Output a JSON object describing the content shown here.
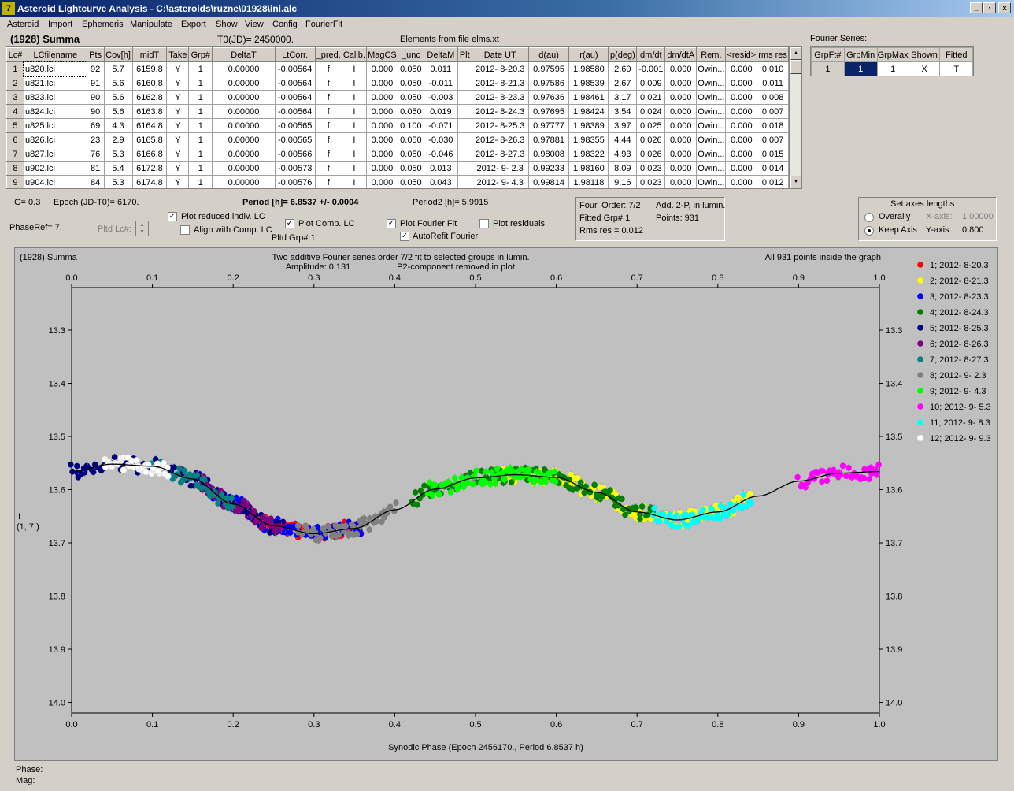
{
  "window": {
    "title": "Asteroid Lightcurve Analysis - C:\\asteroids\\ruzne\\01928\\ini.alc",
    "minimize": "_",
    "maximize": "·",
    "close": "x"
  },
  "menu": [
    "Asteroid",
    "Import",
    "Ephemeris",
    "Manipulate",
    "Export",
    "Show",
    "View",
    "Config",
    "FourierFit"
  ],
  "header": {
    "asteroid": "(1928) Summa",
    "t0": "T0(JD)= 2450000.",
    "elements": "Elements from file elms.xt",
    "fourier_series": "Fourier Series:"
  },
  "table": {
    "columns": [
      "Lc#",
      "LCfilename",
      "Pts",
      "Cov[h]",
      "midT",
      "Take",
      "Grp#",
      "DeltaT",
      "LtCorr.",
      "_pred.",
      "Calib.",
      "MagCS",
      "_unc",
      "DeltaM",
      "Plt",
      "Date UT",
      "d(au)",
      "r(au)",
      "p(deg)",
      "dm/dt",
      "dm/dtA",
      "Rem.",
      "<resid>",
      "rms res"
    ],
    "rows": [
      [
        "1",
        "u820.lci",
        "92",
        "5.7",
        "6159.8",
        "Y",
        "1",
        "0.00000",
        "-0.00564",
        "f",
        "I",
        "0.000",
        "0.050",
        "0.011",
        "",
        "2012- 8-20.3",
        "0.97595",
        "1.98580",
        "2.60",
        "-0.001",
        "0.000",
        "Owin...",
        "0.000",
        "0.010"
      ],
      [
        "2",
        "u821.lci",
        "91",
        "5.6",
        "6160.8",
        "Y",
        "1",
        "0.00000",
        "-0.00564",
        "f",
        "I",
        "0.000",
        "0.050",
        "-0.011",
        "",
        "2012- 8-21.3",
        "0.97586",
        "1.98539",
        "2.67",
        "0.009",
        "0.000",
        "Owin...",
        "0.000",
        "0.011"
      ],
      [
        "3",
        "u823.lci",
        "90",
        "5.6",
        "6162.8",
        "Y",
        "1",
        "0.00000",
        "-0.00564",
        "f",
        "I",
        "0.000",
        "0.050",
        "-0.003",
        "",
        "2012- 8-23.3",
        "0.97636",
        "1.98461",
        "3.17",
        "0.021",
        "0.000",
        "Owin...",
        "0.000",
        "0.008"
      ],
      [
        "4",
        "u824.lci",
        "90",
        "5.6",
        "6163.8",
        "Y",
        "1",
        "0.00000",
        "-0.00564",
        "f",
        "I",
        "0.000",
        "0.050",
        "0.019",
        "",
        "2012- 8-24.3",
        "0.97695",
        "1.98424",
        "3.54",
        "0.024",
        "0.000",
        "Owin...",
        "0.000",
        "0.007"
      ],
      [
        "5",
        "u825.lci",
        "69",
        "4.3",
        "6164.8",
        "Y",
        "1",
        "0.00000",
        "-0.00565",
        "f",
        "I",
        "0.000",
        "0.100",
        "-0.071",
        "",
        "2012- 8-25.3",
        "0.97777",
        "1.98389",
        "3.97",
        "0.025",
        "0.000",
        "Owin...",
        "0.000",
        "0.018"
      ],
      [
        "6",
        "u826.lci",
        "23",
        "2.9",
        "6165.8",
        "Y",
        "1",
        "0.00000",
        "-0.00565",
        "f",
        "I",
        "0.000",
        "0.050",
        "-0.030",
        "",
        "2012- 8-26.3",
        "0.97881",
        "1.98355",
        "4.44",
        "0.026",
        "0.000",
        "Owin...",
        "0.000",
        "0.007"
      ],
      [
        "7",
        "u827.lci",
        "76",
        "5.3",
        "6166.8",
        "Y",
        "1",
        "0.00000",
        "-0.00566",
        "f",
        "I",
        "0.000",
        "0.050",
        "-0.046",
        "",
        "2012- 8-27.3",
        "0.98008",
        "1.98322",
        "4.93",
        "0.026",
        "0.000",
        "Owin...",
        "0.000",
        "0.015"
      ],
      [
        "8",
        "u902.lci",
        "81",
        "5.4",
        "6172.8",
        "Y",
        "1",
        "0.00000",
        "-0.00573",
        "f",
        "I",
        "0.000",
        "0.050",
        "0.013",
        "",
        "2012- 9- 2.3",
        "0.99233",
        "1.98160",
        "8.09",
        "0.023",
        "0.000",
        "Owin...",
        "0.000",
        "0.014"
      ],
      [
        "9",
        "u904.lci",
        "84",
        "5.3",
        "6174.8",
        "Y",
        "1",
        "0.00000",
        "-0.00576",
        "f",
        "I",
        "0.000",
        "0.050",
        "0.043",
        "",
        "2012- 9- 4.3",
        "0.99814",
        "1.98118",
        "9.16",
        "0.023",
        "0.000",
        "Owin...",
        "0.000",
        "0.012"
      ]
    ]
  },
  "fourier_table": {
    "columns": [
      "GrpFt#",
      "GrpMin",
      "GrpMax",
      "Shown",
      "Fitted"
    ],
    "row": [
      "1",
      "1",
      "1",
      "X",
      "T"
    ]
  },
  "controls": {
    "g": "G= 0.3",
    "epoch": "Epoch (JD-T0)= 6170.",
    "period": "Period [h]= 6.8537 +/- 0.0004",
    "period2": "Period2 [h]= 5.9915",
    "phaseref": "PhaseRef= 7.",
    "pltd_lc": "Pltd Lc#:",
    "pltd_grp": "Pltd Grp#  1",
    "plot_reduced": "Plot reduced indiv. LC",
    "align_comp": "Align with Comp. LC",
    "plot_comp": "Plot Comp. LC",
    "plot_fourier": "Plot Fourier Fit",
    "autorefit": "AutoRefit Fourier",
    "plot_residuals": "Plot residuals",
    "check_marks": {
      "plot_reduced": "✓",
      "align_comp": "",
      "plot_comp": "✓",
      "plot_fourier": "✓",
      "autorefit": "✓",
      "plot_residuals": ""
    }
  },
  "info_box": {
    "four_order": "Four. Order:  7/2",
    "add2p": "Add. 2-P, in lumin.",
    "fitted_grp": "Fitted Grp# 1",
    "points": "Points: 931",
    "rms": "Rms res     = 0.012"
  },
  "axes_box": {
    "title": "Set axes lengths",
    "overally": "Overally",
    "keep_axis": "Keep Axis",
    "x_axis_label": "X-axis:",
    "x_axis_value": "1.00000",
    "y_axis_label": "Y-axis:",
    "y_axis_value": "0.800"
  },
  "status": {
    "phase": "Phase:",
    "mag": "Mag:"
  },
  "chart_data": {
    "type": "scatter",
    "title_left": "(1928) Summa",
    "title_center": "Two additive Fourier series order 7/2 fit to selected groups in lumin.",
    "amplitude": "Amplitude: 0.131",
    "p2note": "P2-component removed in plot",
    "title_right": "All 931 points inside the graph",
    "xlabel": "Synodic Phase (Epoch 2456170., Period 6.8537 h)",
    "ylabel": "I",
    "ylabel2": "(1, 7.)",
    "xlim": [
      0.0,
      1.0
    ],
    "ylim": [
      13.22,
      14.02
    ],
    "y_inverted": true,
    "x_ticks": [
      "0.0",
      "0.1",
      "0.2",
      "0.3",
      "0.4",
      "0.5",
      "0.6",
      "0.7",
      "0.8",
      "0.9",
      "1.0"
    ],
    "y_ticks": [
      "13.3",
      "13.4",
      "13.5",
      "13.6",
      "13.7",
      "13.8",
      "13.9",
      "14.0"
    ],
    "fit_curve": {
      "x": [
        0.0,
        0.05,
        0.1,
        0.15,
        0.2,
        0.25,
        0.3,
        0.35,
        0.4,
        0.45,
        0.5,
        0.55,
        0.6,
        0.65,
        0.7,
        0.75,
        0.8,
        0.85,
        0.9,
        0.95,
        1.0
      ],
      "y": [
        13.566,
        13.552,
        13.556,
        13.58,
        13.627,
        13.668,
        13.683,
        13.673,
        13.638,
        13.599,
        13.578,
        13.572,
        13.577,
        13.605,
        13.642,
        13.657,
        13.642,
        13.612,
        13.584,
        13.569,
        13.566
      ]
    },
    "series": [
      {
        "name": "1; 2012- 8-20.3",
        "color": "#ff0000",
        "x_range": [
          0.22,
          0.36
        ]
      },
      {
        "name": "2; 2012- 8-21.3",
        "color": "#ffff00",
        "x_range": [
          0.52,
          0.84
        ]
      },
      {
        "name": "3; 2012- 8-23.3",
        "color": "#0000ff",
        "x_range": [
          0.16,
          0.36
        ]
      },
      {
        "name": "4; 2012- 8-24.3",
        "color": "#008000",
        "x_range": [
          0.42,
          0.72
        ]
      },
      {
        "name": "5; 2012- 8-25.3",
        "color": "#000080",
        "x_range": [
          0.0,
          0.26
        ]
      },
      {
        "name": "6; 2012- 8-26.3",
        "color": "#800080",
        "x_range": [
          0.16,
          0.26
        ]
      },
      {
        "name": "7; 2012- 8-27.3",
        "color": "#008080",
        "x_range": [
          0.1,
          0.2
        ]
      },
      {
        "name": "8; 2012- 9- 2.3",
        "color": "#808080",
        "x_range": [
          0.28,
          0.4
        ]
      },
      {
        "name": "9; 2012- 9- 4.3",
        "color": "#00ff00",
        "x_range": [
          0.44,
          0.6
        ]
      },
      {
        "name": "10; 2012- 9- 5.3",
        "color": "#ff00ff",
        "x_range": [
          0.9,
          1.0
        ]
      },
      {
        "name": "11; 2012- 9- 8.3",
        "color": "#00ffff",
        "x_range": [
          0.72,
          0.84
        ]
      },
      {
        "name": "12; 2012- 9- 9.3",
        "color": "#ffffff",
        "x_range": [
          0.04,
          0.12
        ]
      }
    ]
  }
}
